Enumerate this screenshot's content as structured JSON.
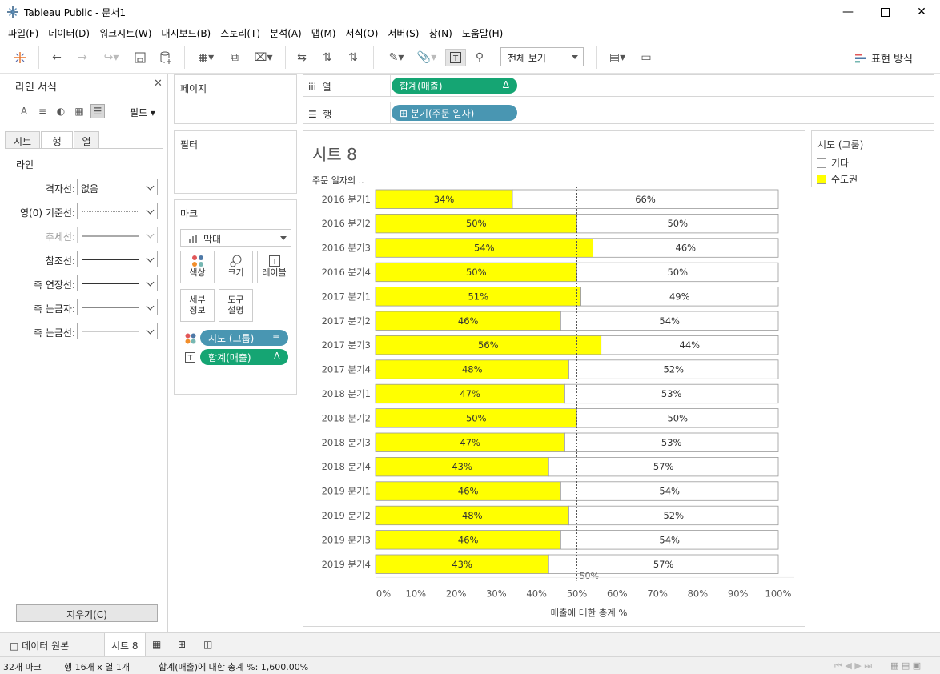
{
  "window": {
    "title": "Tableau Public - 문서1"
  },
  "menu": [
    "파일(F)",
    "데이터(D)",
    "워크시트(W)",
    "대시보드(B)",
    "스토리(T)",
    "분석(A)",
    "맵(M)",
    "서식(O)",
    "서버(S)",
    "창(N)",
    "도움말(H)"
  ],
  "toolbar": {
    "view_select": "전체 보기",
    "show_me": "표현 방식"
  },
  "format_pane": {
    "title": "라인 서식",
    "field_dropdown": "필드",
    "tabs": [
      "시트",
      "행",
      "열"
    ],
    "section": "라인",
    "rows": [
      {
        "label": "격자선:",
        "value": "없음"
      },
      {
        "label": "영(0) 기준선:",
        "value": ""
      },
      {
        "label": "추세선:",
        "value": ""
      },
      {
        "label": "참조선:",
        "value": ""
      },
      {
        "label": "축 연장선:",
        "value": ""
      },
      {
        "label": "축 눈금자:",
        "value": ""
      },
      {
        "label": "축 눈금선:",
        "value": ""
      }
    ],
    "clear_button": "지우기(C)"
  },
  "cards": {
    "pages": "페이지",
    "filters": "필터",
    "marks": "마크",
    "mark_type": "막대",
    "buttons": [
      "색상",
      "크기",
      "레이블",
      "세부\n정보",
      "도구\n설명"
    ],
    "detail": [
      "세부",
      "정보"
    ],
    "tooltip": [
      "도구",
      "설명"
    ],
    "pills": [
      {
        "label": "시도 (그룹)"
      },
      {
        "label": "합계(매출)",
        "badge": "Δ"
      }
    ]
  },
  "shelves": {
    "columns": {
      "label": "열",
      "pill": "합계(매출)",
      "badge": "Δ"
    },
    "rows": {
      "label": "행",
      "pill": "분기(주문 일자)"
    }
  },
  "view": {
    "title": "시트 8",
    "column_header": "주문 일자의 .."
  },
  "legend": {
    "title": "시도 (그룹)",
    "items": [
      {
        "label": "기타",
        "color": "#ffffff"
      },
      {
        "label": "수도권",
        "color": "#ffff00"
      }
    ]
  },
  "chart_data": {
    "type": "bar",
    "stacked": "100%",
    "orientation": "horizontal",
    "categories": [
      "2016 분기1",
      "2016 분기2",
      "2016 분기3",
      "2016 분기4",
      "2017 분기1",
      "2017 분기2",
      "2017 분기3",
      "2017 분기4",
      "2018 분기1",
      "2018 분기2",
      "2018 분기3",
      "2018 분기4",
      "2019 분기1",
      "2019 분기2",
      "2019 분기3",
      "2019 분기4"
    ],
    "series": [
      {
        "name": "수도권",
        "color": "#ffff00",
        "values": [
          34,
          50,
          54,
          50,
          51,
          46,
          56,
          48,
          47,
          50,
          47,
          43,
          46,
          48,
          46,
          43
        ]
      },
      {
        "name": "기타",
        "color": "#ffffff",
        "values": [
          66,
          50,
          46,
          50,
          49,
          54,
          44,
          52,
          53,
          50,
          53,
          57,
          54,
          52,
          54,
          57
        ]
      }
    ],
    "xlabel": "매출에 대한 총계 %",
    "xticks": [
      "0%",
      "10%",
      "20%",
      "30%",
      "40%",
      "50%",
      "60%",
      "70%",
      "80%",
      "90%",
      "100%"
    ],
    "xlim": [
      0,
      100
    ],
    "reference_line": {
      "value": 50,
      "label": "50%",
      "style": "dotted"
    },
    "grid": false
  },
  "sheet_tabs": {
    "data_source": "데이터 원본",
    "active_sheet": "시트 8"
  },
  "status": {
    "marks": "32개 마크",
    "rows_cols": "행 16개  x  열 1개",
    "sum": "합계(매출)에 대한 총계 %: 1,600.00%"
  }
}
